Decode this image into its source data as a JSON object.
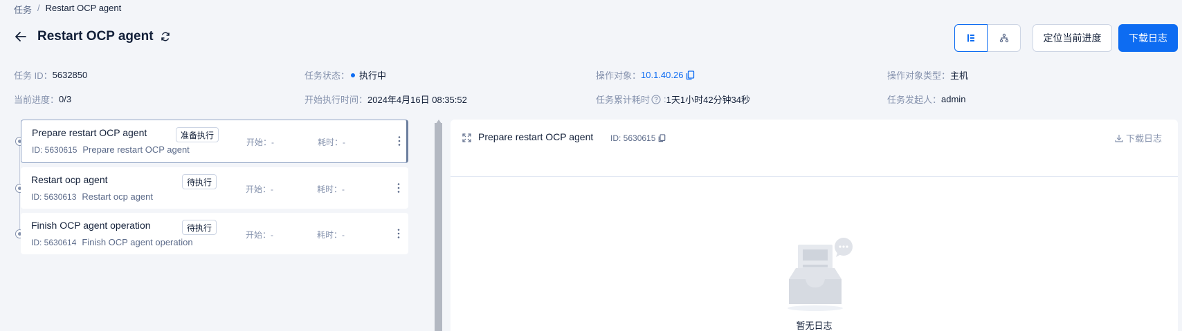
{
  "breadcrumb": {
    "parent": "任务",
    "separator": "/",
    "current": "Restart OCP agent"
  },
  "header": {
    "title": "Restart OCP agent",
    "locate_button": "定位当前进度",
    "download_button": "下载日志"
  },
  "info": {
    "task_id_label": "任务 ID：",
    "task_id": "5632850",
    "status_label": "任务状态：",
    "status": "执行中",
    "target_label": "操作对象：",
    "target": "10.1.40.26",
    "target_type_label": "操作对象类型：",
    "target_type": "主机",
    "progress_label": "当前进度：",
    "progress": "0/3",
    "start_time_label": "开始执行时间：",
    "start_time": "2024年4月16日 08:35:52",
    "elapsed_label": "任务累计耗时",
    "elapsed": "1天1小时42分钟34秒",
    "creator_label": "任务发起人：",
    "creator": "admin"
  },
  "tasks": [
    {
      "name": "Prepare restart OCP agent",
      "tag": "准备执行",
      "id": "ID: 5630615",
      "desc": "Prepare restart OCP agent",
      "start": "开始：-",
      "cost": "耗时：-"
    },
    {
      "name": "Restart ocp agent",
      "tag": "待执行",
      "id": "ID: 5630613",
      "desc": "Restart ocp agent",
      "start": "开始：-",
      "cost": "耗时：-"
    },
    {
      "name": "Finish OCP agent operation",
      "tag": "待执行",
      "id": "ID: 5630614",
      "desc": "Finish OCP agent operation",
      "start": "开始：-",
      "cost": "耗时：-"
    }
  ],
  "log_panel": {
    "title": "Prepare restart OCP agent",
    "id": "ID: 5630615",
    "download": "下载日志",
    "empty_text": "暂无日志"
  },
  "colors": {
    "primary": "#0d6cf2",
    "text": "#132039",
    "muted": "#8592ad",
    "background": "#f3f5f9"
  }
}
